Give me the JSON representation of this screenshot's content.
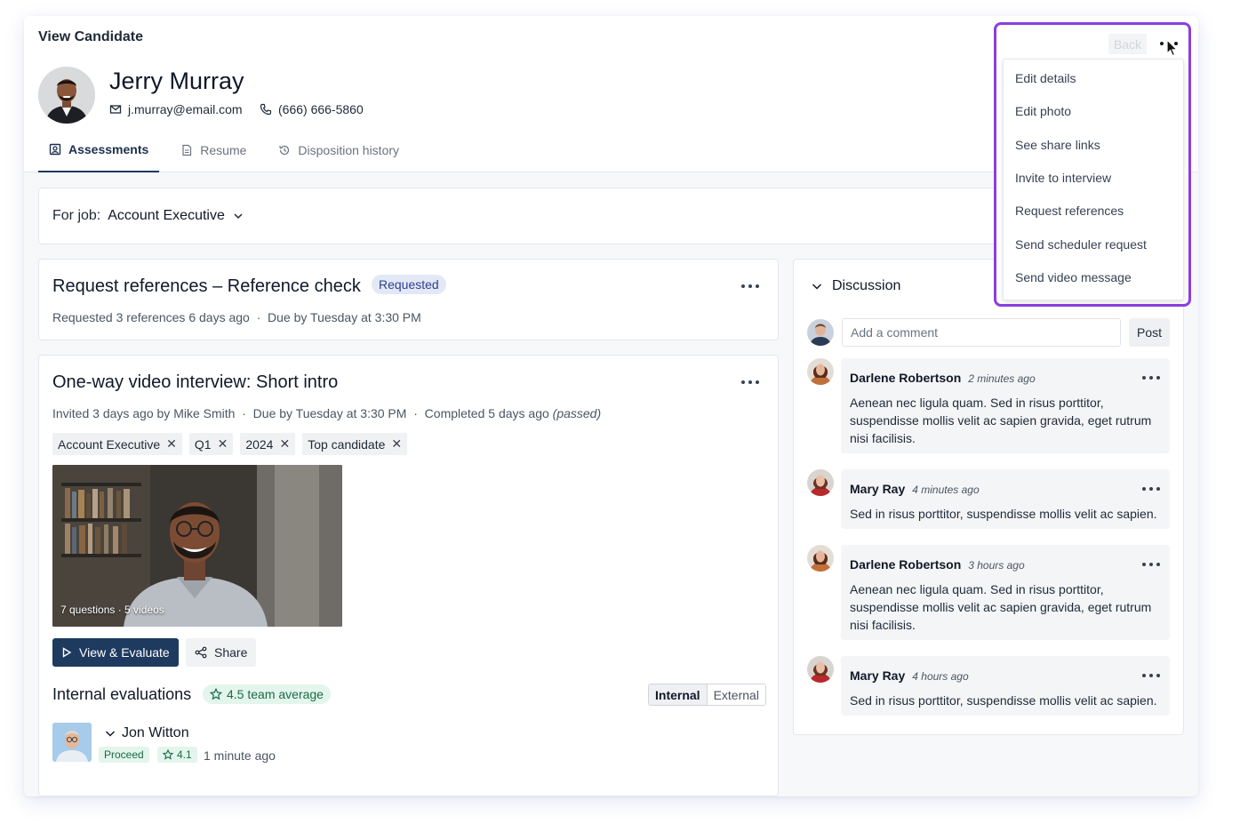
{
  "page": {
    "title": "View Candidate"
  },
  "candidate": {
    "name": "Jerry Murray",
    "email": "j.murray@email.com",
    "phone": "(666) 666-5860"
  },
  "tabs": [
    {
      "label": "Assessments",
      "active": true
    },
    {
      "label": "Resume"
    },
    {
      "label": "Disposition history"
    }
  ],
  "job": {
    "label": "For job:",
    "value": "Account Executive"
  },
  "reference": {
    "title": "Request references – Reference check",
    "badge": "Requested",
    "meta_left": "Requested 3 references 6 days ago",
    "separator": "·",
    "meta_right": "Due by Tuesday at 3:30 PM"
  },
  "video_interview": {
    "title": "One-way video interview: Short intro",
    "invited": "Invited 3 days ago by Mike Smith",
    "due": "Due by Tuesday at 3:30 PM",
    "completed": "Completed 5 days ago",
    "status": "(passed)",
    "separator": "·",
    "tags": [
      "Account Executive",
      "Q1",
      "2024",
      "Top candidate"
    ],
    "tag_remove": "✕",
    "video_caption": "7 questions · 5 videos",
    "view_button": "View & Evaluate",
    "share_button": "Share"
  },
  "evaluations": {
    "title": "Internal evaluations",
    "average": "4.5 team average",
    "toggle": [
      "Internal",
      "External"
    ],
    "evaluator": {
      "name": "Jon Witton",
      "decision": "Proceed",
      "rating": "4.1",
      "time": "1 minute ago"
    }
  },
  "discussion": {
    "title": "Discussion",
    "placeholder": "Add a comment",
    "post": "Post",
    "comments": [
      {
        "author": "Darlene Robertson",
        "time": "2 minutes ago",
        "text": "Aenean nec ligula quam. Sed in risus porttitor, suspendisse mollis velit ac sapien gravida, eget rutrum nisi facilisis."
      },
      {
        "author": "Mary Ray",
        "time": "4 minutes ago",
        "text": "Sed in risus porttitor, suspendisse mollis velit ac sapien."
      },
      {
        "author": "Darlene Robertson",
        "time": "3 hours ago",
        "text": "Aenean nec ligula quam. Sed in risus porttitor, suspendisse mollis velit ac sapien gravida, eget rutrum nisi facilisis."
      },
      {
        "author": "Mary Ray",
        "time": "4 hours ago",
        "text": "Sed in risus porttitor, suspendisse mollis velit ac sapien."
      }
    ]
  },
  "menu": {
    "back": "Back",
    "items": [
      "Edit details",
      "Edit photo",
      "See share links",
      "Invite to interview",
      "Request references",
      "Send scheduler request",
      "Send video message"
    ]
  },
  "colors": {
    "accent": "#1e3a5f",
    "highlight": "#8b3ee0",
    "badge_blue": "#e3e8f7",
    "badge_green": "#e3f5ec"
  }
}
